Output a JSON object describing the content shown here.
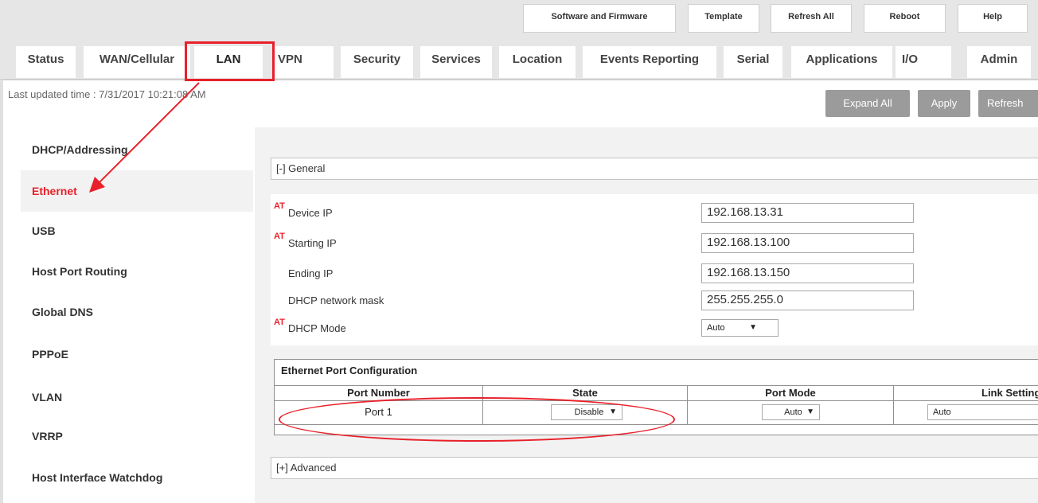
{
  "top_actions": [
    "Software and Firmware",
    "Template",
    "Refresh All",
    "Reboot",
    "Help"
  ],
  "tabs": [
    "Status",
    "WAN/Cellular",
    "LAN",
    "VPN",
    "Security",
    "Services",
    "Location",
    "Events Reporting",
    "Serial",
    "Applications",
    "I/O",
    "Admin"
  ],
  "active_tab": "LAN",
  "last_updated": "Last updated time : 7/31/2017 10:21:08 AM",
  "actions": {
    "expand_all": "Expand All",
    "apply": "Apply",
    "refresh": "Refresh"
  },
  "sidebar": [
    "DHCP/Addressing",
    "Ethernet",
    "USB",
    "Host Port Routing",
    "Global DNS",
    "PPPoE",
    "VLAN",
    "VRRP",
    "Host Interface Watchdog"
  ],
  "active_sidebar": "Ethernet",
  "general": {
    "header": "[-] General",
    "rows": [
      {
        "at": "AT",
        "label": "Device IP",
        "value": "192.168.13.31"
      },
      {
        "at": "AT",
        "label": "Starting IP",
        "value": "192.168.13.100"
      },
      {
        "at": "",
        "label": "Ending IP",
        "value": "192.168.13.150"
      },
      {
        "at": "",
        "label": "DHCP network mask",
        "value": "255.255.255.0"
      }
    ],
    "dhcp_mode": {
      "at": "AT",
      "label": "DHCP Mode",
      "value": "Auto",
      "arrow": "▼"
    }
  },
  "ethernet_port_config": {
    "title": "Ethernet Port Configuration",
    "columns": [
      "Port Number",
      "State",
      "Port Mode",
      "Link Setting"
    ],
    "row": {
      "port": "Port 1",
      "state": "Disable",
      "port_mode": "Auto",
      "link_setting": "Auto",
      "arrow": "▼"
    }
  },
  "advanced": {
    "header": "[+] Advanced"
  },
  "annotation_color": "#e8202a"
}
